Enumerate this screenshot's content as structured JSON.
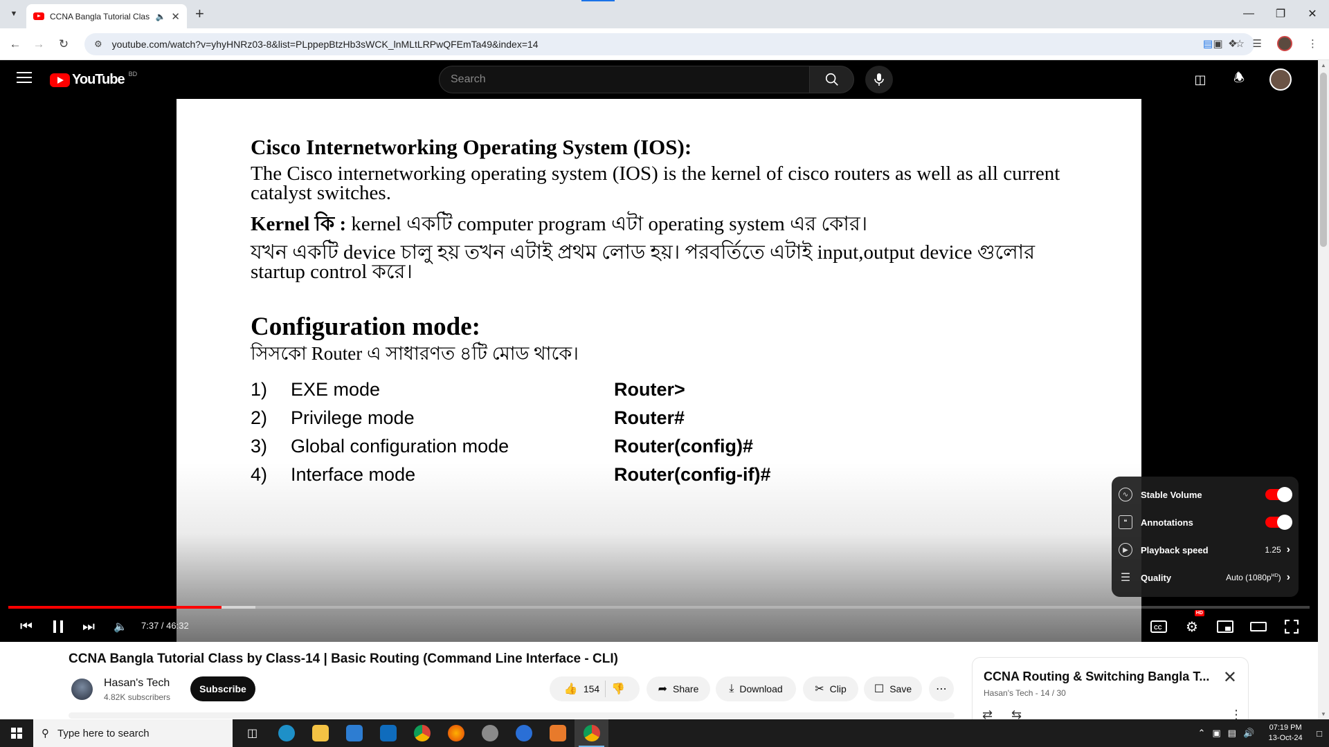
{
  "browser": {
    "tab_title": "CCNA Bangla Tutorial Class",
    "new_tab": "+",
    "url": "youtube.com/watch?v=yhyHNRz03-8&list=PLppepBtzHb3sWCK_lnMLtLRPwQFEmTa49&index=14"
  },
  "youtube": {
    "logo_text": "YouTube",
    "country_code": "BD",
    "search_placeholder": "Search"
  },
  "slide": {
    "heading": "Cisco Internetworking Operating System (IOS):",
    "paragraph": "The Cisco internetworking operating system (IOS) is the kernel of cisco routers as well as all current catalyst switches.",
    "kernel_label": "Kernel কি :",
    "kernel_text": " kernel একটি computer program এটা operating system এর কোর।",
    "boot_text": "যখন একটি device চালু হয় তখন এটাই  প্রথম লোড হয়। পরবর্তিতে এটাই input,output device গুলোর startup control করে।",
    "config_heading": "Configuration mode:",
    "config_intro": "সিসকো Router এ সাধারণত ৪টি মোড থাকে।",
    "modes": [
      {
        "num": "1)",
        "name": "EXE mode",
        "prompt": "Router>"
      },
      {
        "num": "2)",
        "name": "Privilege mode",
        "prompt": "Router#"
      },
      {
        "num": "3)",
        "name": "Global configuration mode",
        "prompt": "Router(config)#"
      },
      {
        "num": "4)",
        "name": "Interface mode",
        "prompt": "Router(config-if)#"
      }
    ]
  },
  "player": {
    "time_display": "7:37 / 46:32",
    "played_fraction": 0.164,
    "buffered_fraction": 0.19,
    "settings": {
      "stable_volume": "Stable Volume",
      "annotations": "Annotations",
      "playback_speed": "Playback speed",
      "playback_speed_value": "1.25",
      "quality": "Quality",
      "quality_value": "Auto (1080p",
      "quality_badge": "HD",
      "stable_volume_on": true,
      "annotations_on": true
    },
    "hd_badge": "HD"
  },
  "video": {
    "title": "CCNA Bangla Tutorial Class by Class-14 | Basic Routing (Command Line Interface - CLI)",
    "channel_name": "Hasan's Tech",
    "subscribers": "4.82K subscribers",
    "subscribe_label": "Subscribe",
    "likes": "154",
    "share_label": "Share",
    "download_label": "Download",
    "clip_label": "Clip",
    "save_label": "Save"
  },
  "playlist": {
    "title": "CCNA Routing & Switching Bangla T...",
    "subtitle": "Hasan's Tech - 14 / 30"
  },
  "taskbar": {
    "search_placeholder": "Type here to search",
    "time": "07:19 PM",
    "date": "13-Oct-24"
  },
  "colors": {
    "youtube_red": "#ff0000",
    "player_bg": "#000000",
    "taskbar_bg": "#1c1c1c"
  }
}
